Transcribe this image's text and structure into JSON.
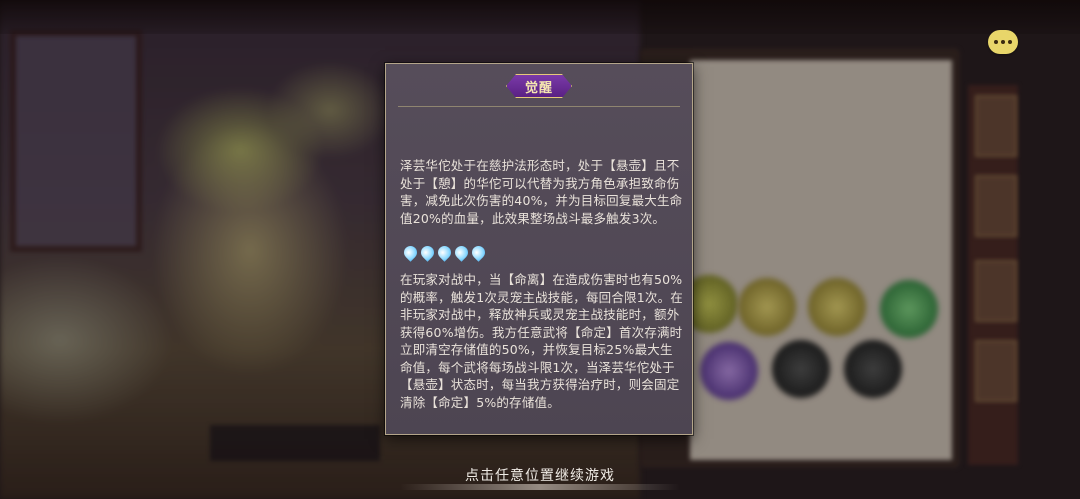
{
  "tooltip": {
    "badge": "觉醒",
    "dashes": "------------------------",
    "para1": "泽芸华佗处于在慈护法形态时，处于【悬壶】且不处于【憩】的华佗可以代替为我方角色承担致命伤害，减免此次伤害的40%，并为目标回复最大生命值20%的血量，此效果整场战斗最多触发3次。",
    "drops_count": 5,
    "para2": "在玩家对战中，当【命离】在造成伤害时也有50%的概率，触发1次灵宠主战技能，每回合限1次。在非玩家对战中，释放神兵或灵宠主战技能时，额外获得60%增伤。我方任意武将【命定】首次存满时立即清空存储值的50%，并恢复目标25%最大生命值，每个武将每场战斗限1次，当泽芸华佗处于【悬壶】状态时，每当我方获得治疗时，则会固定清除【命定】5%的存储值。"
  },
  "prompt": "点击任意位置继续游戏",
  "icons": {
    "chat": "chat-bubble-icon",
    "drop": "water-drop-icon"
  },
  "colors": {
    "panel_bg": "#524957",
    "badge_bg": "#6a2c98",
    "text": "#e9e2da",
    "accent_gold": "#e6c97a"
  }
}
